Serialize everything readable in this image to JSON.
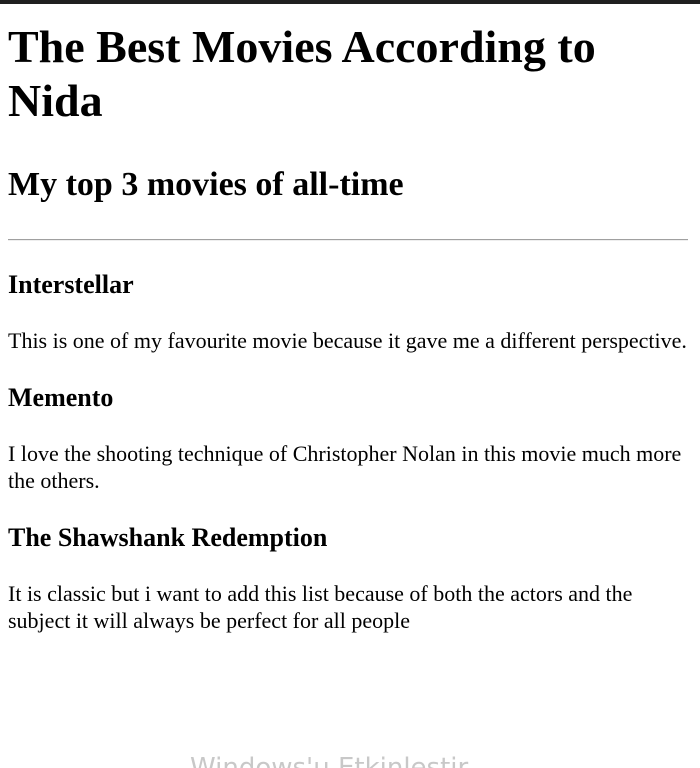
{
  "page": {
    "title": "The Best Movies According to Nida",
    "subtitle": "My top 3 movies of all-time"
  },
  "movies": [
    {
      "title": "Interstellar",
      "description": "This is one of my favourite movie because it gave me a different perspective."
    },
    {
      "title": "Memento",
      "description": "I love the shooting technique of Christopher Nolan in this movie much more the others."
    },
    {
      "title": "The Shawshank Redemption",
      "description": "It is classic but i want to add this list because of both the actors and the subject it will always be perfect for all people"
    }
  ],
  "watermark": {
    "text": "Windows'u Etkinleştir"
  }
}
